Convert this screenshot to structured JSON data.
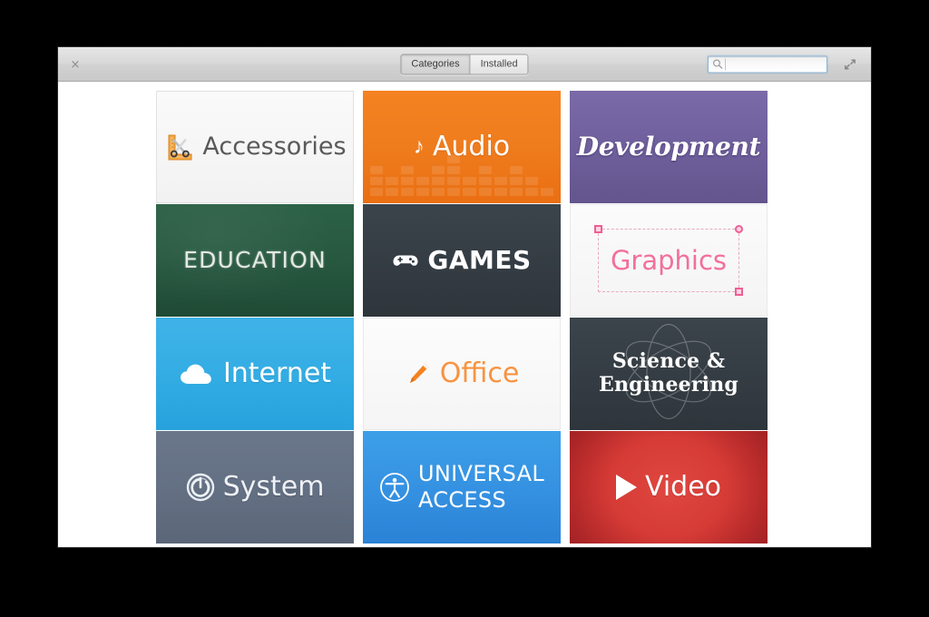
{
  "window": {
    "close_label": "×",
    "toolbar": {
      "segments": [
        {
          "label": "Categories",
          "active": true
        },
        {
          "label": "Installed",
          "active": false
        }
      ],
      "search": {
        "value": "",
        "placeholder": "",
        "icon": "search-icon"
      },
      "expand": {
        "icon": "fullscreen-expand-icon"
      }
    }
  },
  "grid": {
    "tiles": [
      {
        "id": "accessories",
        "label": "Accessories",
        "icon": "ruler-scissors-icon",
        "bg": "#f5f5f5",
        "text_color": "#595959"
      },
      {
        "id": "audio",
        "label": "Audio",
        "icon": "music-note-icon",
        "bg": "#f0801f",
        "text_color": "#ffffff"
      },
      {
        "id": "development",
        "label": "Development",
        "icon": "none",
        "bg": "#6f5f9c",
        "text_color": "#ffffff"
      },
      {
        "id": "education",
        "label": "EDUCATION",
        "icon": "none",
        "bg": "#275840",
        "text_color": "#f0f4ef"
      },
      {
        "id": "games",
        "label": "GAMES",
        "icon": "gamepad-icon",
        "bg": "#353d44",
        "text_color": "#ffffff"
      },
      {
        "id": "graphics",
        "label": "Graphics",
        "icon": "selection-marquee-icon",
        "bg": "#f7f7f7",
        "text_color": "#f2709c"
      },
      {
        "id": "internet",
        "label": "Internet",
        "icon": "cloud-icon",
        "bg": "#33ade4",
        "text_color": "#ffffff"
      },
      {
        "id": "office",
        "label": "Office",
        "icon": "pencil-icon",
        "bg": "#f7f7f7",
        "text_color": "#f79340"
      },
      {
        "id": "science",
        "label": "Science &\nEngineering",
        "icon": "atom-icon",
        "bg": "#353d44",
        "text_color": "#ffffff"
      },
      {
        "id": "system",
        "label": "System",
        "icon": "power-icon",
        "bg": "#647083",
        "text_color": "#eef1f5"
      },
      {
        "id": "universal-access",
        "label": "UNIVERSAL\nACCESS",
        "icon": "accessibility-icon",
        "bg": "#3592e2",
        "text_color": "#ffffff"
      },
      {
        "id": "video",
        "label": "Video",
        "icon": "play-icon",
        "bg": "#d63b36",
        "text_color": "#ffffff"
      }
    ]
  }
}
